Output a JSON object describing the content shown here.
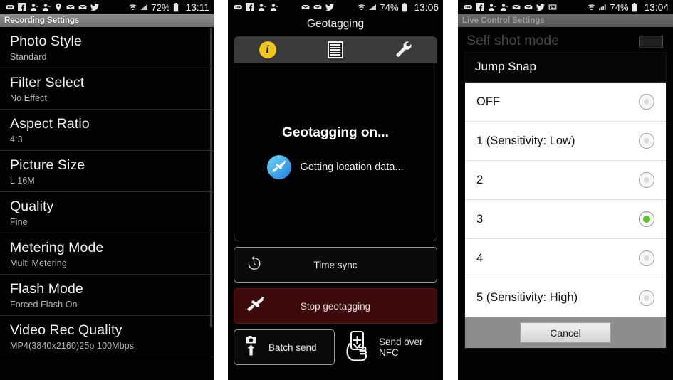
{
  "panel1": {
    "statusbar": {
      "icons": [
        "message-icon",
        "facebook-icon",
        "contact-icon",
        "contact-icon",
        "location-pin-icon",
        "mail-icon",
        "mail-icon",
        "twitter-icon"
      ],
      "wifi": "wifi-icon",
      "signal": "signal-icon",
      "battery_pct": "72%",
      "battery": "battery-icon",
      "time": "13:11"
    },
    "title": "Recording Settings",
    "items": [
      {
        "label": "Photo Style",
        "value": "Standard"
      },
      {
        "label": "Filter Select",
        "value": "No Effect"
      },
      {
        "label": "Aspect Ratio",
        "value": "4:3"
      },
      {
        "label": "Picture Size",
        "value": "L 16M"
      },
      {
        "label": "Quality",
        "value": "Fine"
      },
      {
        "label": "Metering Mode",
        "value": "Multi Metering"
      },
      {
        "label": "Flash Mode",
        "value": "Forced Flash On"
      },
      {
        "label": "Video Rec Quality",
        "value": "MP4(3840x2160)25p 100Mbps"
      }
    ]
  },
  "panel2": {
    "statusbar": {
      "icons": [
        "message-icon",
        "facebook-icon",
        "contact-icon",
        "contact-icon",
        "mail-icon",
        "mail-icon",
        "twitter-icon"
      ],
      "battery_pct": "74%",
      "time": "13:06"
    },
    "title": "Geotagging",
    "tabs": [
      {
        "name": "info-tab",
        "icon": "info-circle-icon",
        "selected": true,
        "glyph": "i"
      },
      {
        "name": "log-tab",
        "icon": "document-list-icon",
        "selected": false
      },
      {
        "name": "settings-tab",
        "icon": "wrench-icon",
        "selected": false
      }
    ],
    "status_heading": "Geotagging on...",
    "status_sub": "Getting location data...",
    "status_icon": "satellite-icon",
    "buttons": {
      "time_sync": {
        "label": "Time sync",
        "icon": "time-sync-icon"
      },
      "stop_geotagging": {
        "label": "Stop geotagging",
        "icon": "satellite-icon"
      },
      "batch_send": {
        "label": "Batch send",
        "icon": "camera-upload-icon"
      },
      "send_nfc": {
        "label": "Send over NFC",
        "icon": "nfc-hand-icon"
      }
    }
  },
  "panel3": {
    "statusbar": {
      "icons": [
        "message-icon",
        "facebook-icon",
        "contact-icon",
        "contact-icon",
        "mail-icon",
        "mail-icon",
        "twitter-icon",
        "image-icon"
      ],
      "battery_pct": "74%",
      "time": "13:04"
    },
    "title": "Live Control Settings",
    "background_row": {
      "label": "Self shot mode"
    },
    "dialog": {
      "title": "Jump Snap",
      "options": [
        {
          "label": "OFF",
          "selected": false
        },
        {
          "label": "1 (Sensitivity: Low)",
          "selected": false
        },
        {
          "label": "2",
          "selected": false
        },
        {
          "label": "3",
          "selected": true
        },
        {
          "label": "4",
          "selected": false
        },
        {
          "label": "5 (Sensitivity: High)",
          "selected": false
        }
      ],
      "cancel_label": "Cancel"
    }
  },
  "colors": {
    "accent_yellow": "#f0c419",
    "selected_green": "#5ec12a",
    "stop_red": "#3c0a0a",
    "satellite_blue": "#1f7fe0"
  }
}
